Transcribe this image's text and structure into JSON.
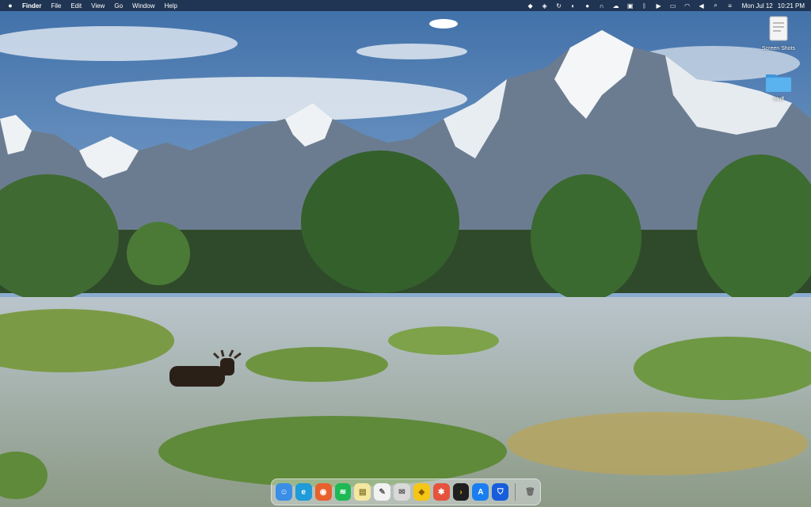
{
  "menubar": {
    "app_name": "Finder",
    "menus": [
      "File",
      "Edit",
      "View",
      "Go",
      "Window",
      "Help"
    ],
    "status_icons": [
      "dropbox-icon",
      "dashlane-icon",
      "sync-icon",
      "finder-guard-icon",
      "circle-icon",
      "headphones-icon",
      "cloud-icon",
      "clipboard-icon",
      "bluetooth-icon",
      "play-icon",
      "battery-icon",
      "wifi-icon",
      "volume-icon",
      "search-icon",
      "control-center-icon"
    ],
    "clock": {
      "date": "Mon Jul 12",
      "time": "10:21 PM"
    }
  },
  "desktop": {
    "icons": [
      {
        "name": "Screen Shots",
        "type": "document"
      },
      {
        "name": "Stuff",
        "type": "folder"
      }
    ]
  },
  "dock": {
    "apps": [
      {
        "name": "Finder",
        "icon": "finder-icon",
        "color": "#3a8ee6",
        "glyph": "☺"
      },
      {
        "name": "Microsoft Edge",
        "icon": "edge-icon",
        "color": "#1e9bd8",
        "glyph": "e"
      },
      {
        "name": "Firefox",
        "icon": "firefox-icon",
        "color": "#e8602c",
        "glyph": "◉"
      },
      {
        "name": "Spotify",
        "icon": "spotify-icon",
        "color": "#1db954",
        "glyph": "≋"
      },
      {
        "name": "Notes",
        "icon": "notes-icon",
        "color": "#f4e7a0",
        "glyph": "▤"
      },
      {
        "name": "TextEdit",
        "icon": "textedit-icon",
        "color": "#f2f2f2",
        "glyph": "✎"
      },
      {
        "name": "Mail",
        "icon": "mail-icon",
        "color": "#d9d9d9",
        "glyph": "✉"
      },
      {
        "name": "Stickies",
        "icon": "stickies-icon",
        "color": "#f5c518",
        "glyph": "◆"
      },
      {
        "name": "Scrivener",
        "icon": "scrivener-icon",
        "color": "#e5533d",
        "glyph": "✱"
      },
      {
        "name": "Prompt",
        "icon": "terminal-icon",
        "color": "#1f1f1f",
        "glyph": "›"
      },
      {
        "name": "App Store",
        "icon": "app-store-icon",
        "color": "#1a7ef2",
        "glyph": "A"
      },
      {
        "name": "Bitwarden",
        "icon": "bitwarden-icon",
        "color": "#175ddc",
        "glyph": "⛉"
      }
    ],
    "trash": {
      "name": "Trash",
      "icon": "trash-icon",
      "color": "#e8e8e8",
      "glyph": "🗑"
    }
  },
  "colors": {
    "menubar_bg": "#1c2538",
    "dock_bg": "#e6ebf0",
    "folder": "#4aa8e8"
  }
}
